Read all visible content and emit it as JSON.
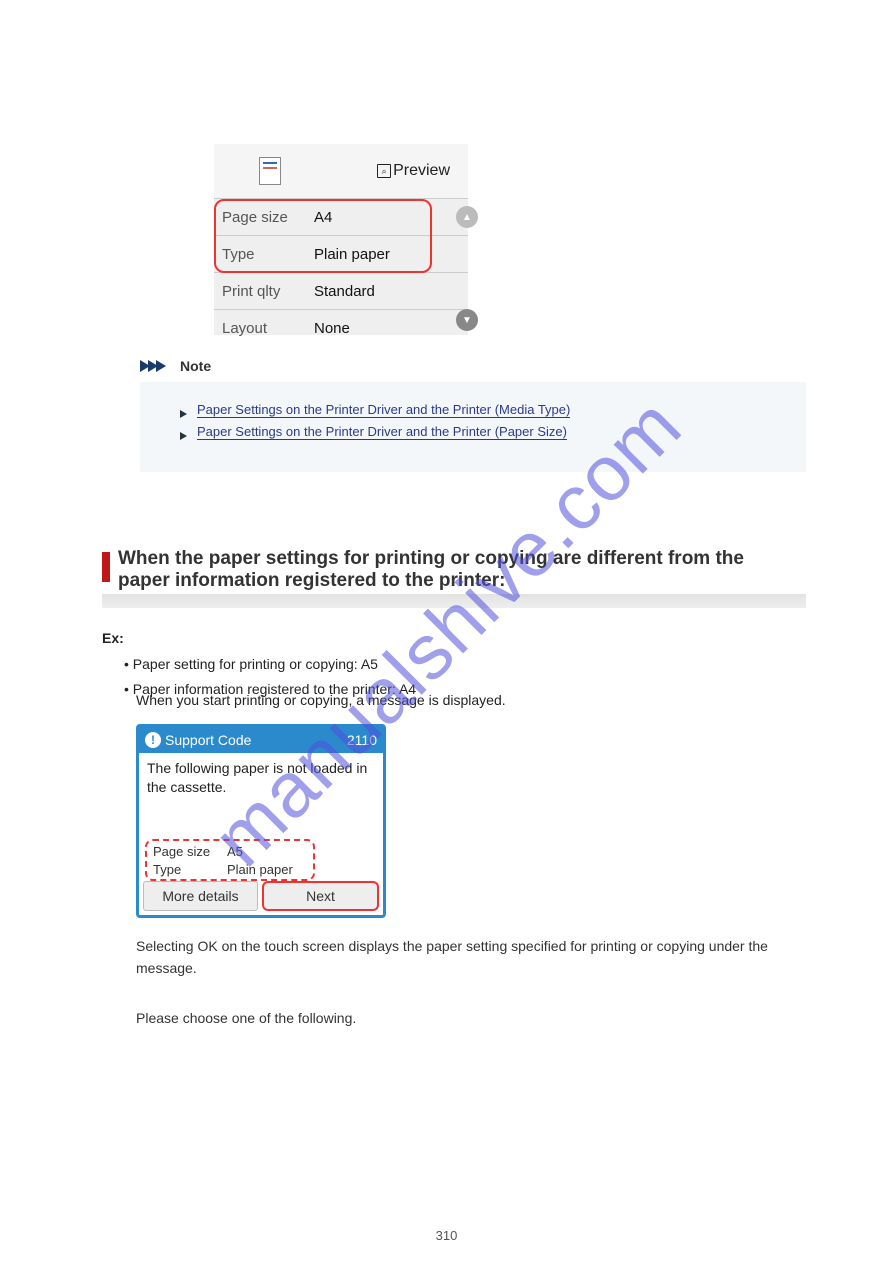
{
  "watermark": "manualshive.com",
  "settings_panel": {
    "preview_label": "Preview",
    "rows": [
      {
        "label": "Page size",
        "value": "A4"
      },
      {
        "label": "Type",
        "value": "Plain paper"
      },
      {
        "label": "Print qlty",
        "value": "Standard"
      },
      {
        "label": "Layout",
        "value": "None"
      }
    ]
  },
  "note": {
    "heading": "Note",
    "links": [
      "Paper Settings on the Printer Driver and the Printer (Media Type)",
      "Paper Settings on the Printer Driver and the Printer (Paper Size)"
    ]
  },
  "section": {
    "title": "When the paper settings for printing or copying are different from the paper information registered to the printer:",
    "intro_label": "Ex:",
    "bullets": [
      "Paper setting for printing or copying: A5",
      "Paper information registered to the printer: A4"
    ],
    "lead_in": "When you start printing or copying, a message is displayed."
  },
  "support_dialog": {
    "header_label": "Support Code",
    "code": "2110",
    "message": "The following paper is not loaded in the cassette.",
    "info": {
      "page_size_label": "Page size",
      "page_size_value": "A5",
      "type_label": "Type",
      "type_value": "Plain paper"
    },
    "buttons": {
      "more": "More details",
      "next": "Next"
    }
  },
  "after": {
    "p1": "Selecting OK on the touch screen displays the paper setting specified for printing or copying under the message.",
    "p2": "Please choose one of the following."
  },
  "page_number": "310"
}
